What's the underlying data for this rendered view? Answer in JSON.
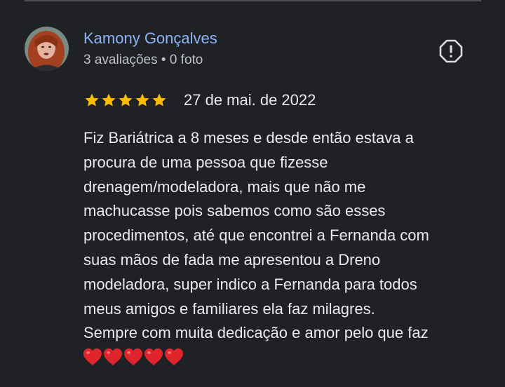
{
  "review": {
    "reviewer_name": "Kamony Gonçalves",
    "reviewer_meta": "3 avaliações • 0 foto",
    "rating": 5,
    "rating_max": 5,
    "date": "27 de mai. de 2022",
    "text_lines": [
      "Fiz Bariátrica a 8 meses e desde então estava a",
      "procura de uma pessoa que fizesse",
      "drenagem/modeladora, mais que não me",
      "machucasse pois sabemos como são esses",
      "procedimentos, até que encontrei a Fernanda com",
      "suas mãos de fada me apresentou a Dreno",
      "modeladora, super indico a Fernanda para todos",
      "meus amigos e familiares ela faz milagres.",
      "Sempre com muita dedicação e amor pelo que faz"
    ],
    "hearts": [
      "❤️",
      "❤️",
      "❤️",
      "❤️",
      "❤️"
    ]
  },
  "icons": {
    "report": "report-flag-icon",
    "star": "star-icon",
    "heart": "heart-icon"
  },
  "colors": {
    "background": "#202124",
    "name": "#8ab4f8",
    "meta": "#bdc1c6",
    "text": "#e8eaed",
    "star": "#fbbc04",
    "heart": "#e0242b",
    "icon": "#dadce0"
  }
}
